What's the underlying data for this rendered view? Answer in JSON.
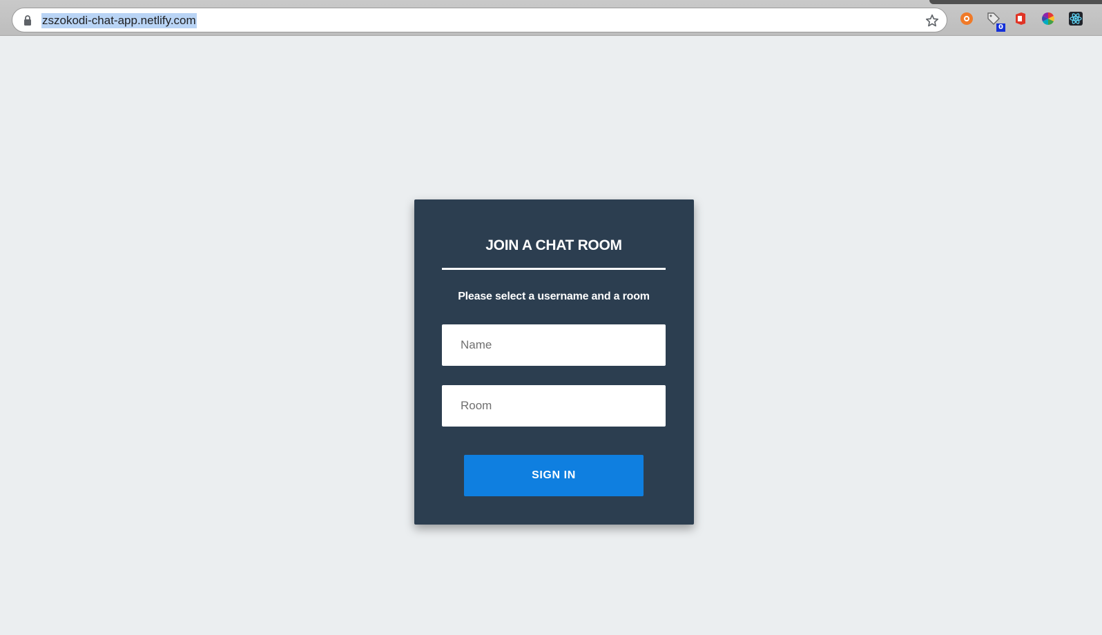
{
  "browser": {
    "url": "zszokodi-chat-app.netlify.com",
    "extensions": [
      {
        "name": "ublock-icon",
        "color": "#f07a28"
      },
      {
        "name": "tag-icon",
        "badge": "0"
      },
      {
        "name": "office-icon",
        "color": "#e03426"
      },
      {
        "name": "color-wheel-icon"
      },
      {
        "name": "react-devtools-icon",
        "color": "#61dafb"
      }
    ]
  },
  "card": {
    "title": "JOIN A CHAT ROOM",
    "subtitle": "Please select a username and a room",
    "name_placeholder": "Name",
    "room_placeholder": "Room",
    "signin_label": "SIGN IN"
  },
  "colors": {
    "card_bg": "#2c3e50",
    "page_bg": "#ebeef0",
    "button_bg": "#0f7fe0"
  }
}
